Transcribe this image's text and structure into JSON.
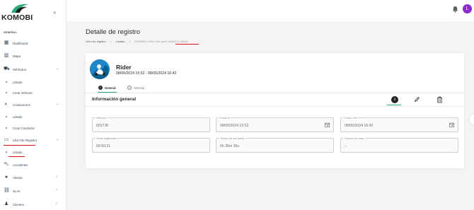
{
  "brand": {
    "name": "KOMOBI",
    "accent": "#2aa876"
  },
  "sidebar": {
    "section_label": "GENERAL",
    "items": [
      {
        "label": "Dashboard",
        "icon": "dashboard-icon"
      },
      {
        "label": "Mapa",
        "icon": "map-icon"
      },
      {
        "label": "Vehículos",
        "icon": "motorcycle-icon",
        "sub": [
          {
            "label": "Listado"
          },
          {
            "label": "Crear Vehículo"
          }
        ]
      },
      {
        "label": "Conductores",
        "icon": "driver-icon",
        "sub": [
          {
            "label": "Listado"
          },
          {
            "label": "Crear Conductor"
          }
        ]
      },
      {
        "label": "Libro De Registro",
        "icon": "book-icon",
        "sub": [
          {
            "label": "Listado"
          }
        ]
      },
      {
        "label": "Accidentes",
        "icon": "truck-icon"
      },
      {
        "label": "Alertas",
        "icon": "alert-icon"
      },
      {
        "label": "SLAs",
        "icon": "link-icon"
      },
      {
        "label": "Clientes",
        "icon": "user-icon"
      }
    ]
  },
  "topbar": {
    "avatar_initial": "L",
    "avatar_color": "#8a2ccf"
  },
  "page": {
    "title": "Detalle de registro",
    "breadcrumb": [
      "Libro de registro",
      "Listado",
      "b50c9800-165c-11ef-aea7-d89e67c-d89b9"
    ]
  },
  "rider": {
    "name": "Rider",
    "dates": "08/05/2024 15:52 - 08/05/2024 16:42"
  },
  "tabs": [
    {
      "label": "General",
      "active": true
    },
    {
      "label": "Historial",
      "active": false
    }
  ],
  "info": {
    "heading": "Información general",
    "fields": [
      {
        "label": "Vehículo",
        "value": "0017JK"
      },
      {
        "label": "Check In",
        "value": "08/05/2024 15:52"
      },
      {
        "label": "Check Out",
        "value": "08/05/2024 16:42"
      },
      {
        "label": "Horas registradas",
        "value": "00:50:21"
      },
      {
        "label": "Tiempo de uso (total)",
        "value": "0h 36m 36s"
      },
      {
        "label": "Número de notas",
        "value": "--"
      }
    ]
  }
}
